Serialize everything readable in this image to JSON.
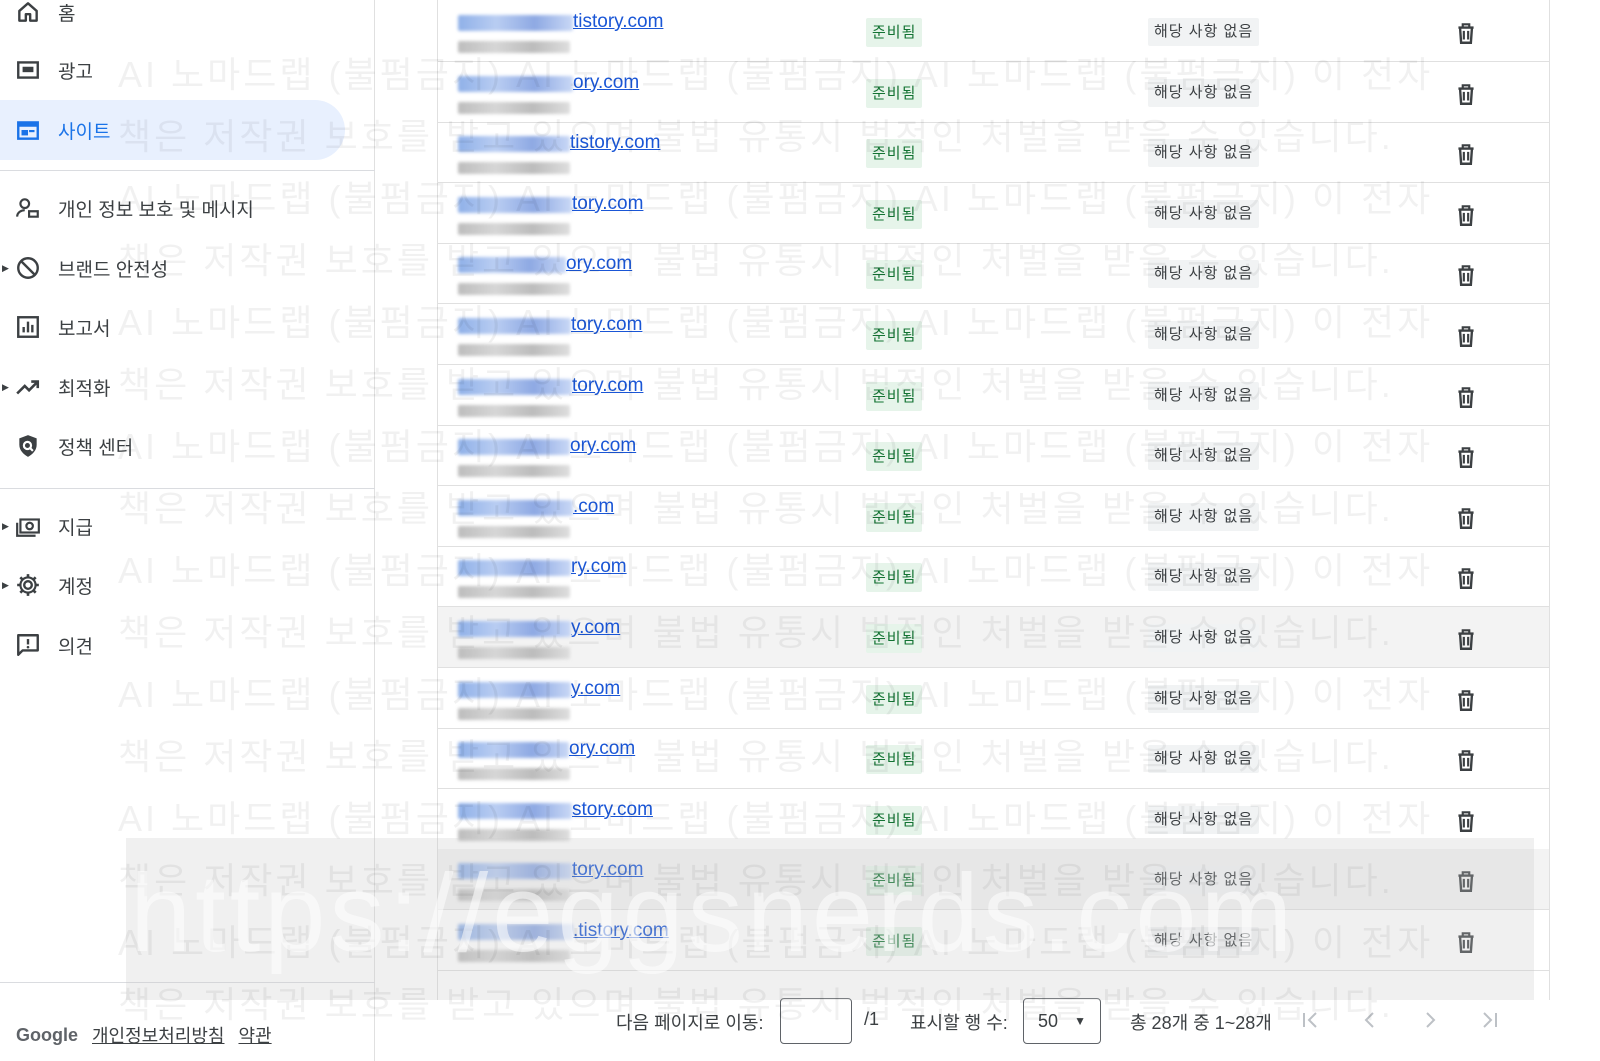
{
  "sidebar": {
    "items": [
      {
        "label": "홈",
        "icon": "home-icon"
      },
      {
        "label": "광고",
        "icon": "ads-icon"
      },
      {
        "label": "사이트",
        "icon": "sites-icon",
        "active": true
      },
      {
        "label": "개인 정보 보호 및 메시지",
        "icon": "privacy-messaging-icon"
      },
      {
        "label": "브랜드 안전성",
        "icon": "block-icon",
        "expandable": true
      },
      {
        "label": "보고서",
        "icon": "reports-icon"
      },
      {
        "label": "최적화",
        "icon": "trending-up-icon",
        "expandable": true
      },
      {
        "label": "정책 센터",
        "icon": "policy-shield-icon"
      },
      {
        "label": "지급",
        "icon": "payments-icon",
        "expandable": true
      },
      {
        "label": "계정",
        "icon": "gear-icon",
        "expandable": true
      },
      {
        "label": "의견",
        "icon": "feedback-icon"
      }
    ],
    "footer": {
      "brand": "Google",
      "privacy_link": "개인정보처리방침",
      "terms_link": "약관"
    }
  },
  "table": {
    "rows": [
      {
        "site": "tistory.com",
        "status": "준비됨",
        "issues": "해당 사항 없음"
      },
      {
        "site": "ory.com",
        "status": "준비됨",
        "issues": "해당 사항 없음"
      },
      {
        "site": "tistory.com",
        "status": "준비됨",
        "issues": "해당 사항 없음"
      },
      {
        "site": "tory.com",
        "status": "준비됨",
        "issues": "해당 사항 없음"
      },
      {
        "site": "ory.com",
        "status": "준비됨",
        "issues": "해당 사항 없음"
      },
      {
        "site": "tory.com",
        "status": "준비됨",
        "issues": "해당 사항 없음"
      },
      {
        "site": "tory.com",
        "status": "준비됨",
        "issues": "해당 사항 없음"
      },
      {
        "site": "ory.com",
        "status": "준비됨",
        "issues": "해당 사항 없음"
      },
      {
        "site": ".com",
        "status": "준비됨",
        "issues": "해당 사항 없음"
      },
      {
        "site": "ry.com",
        "status": "준비됨",
        "issues": "해당 사항 없음"
      },
      {
        "site": "y.com",
        "status": "준비됨",
        "issues": "해당 사항 없음"
      },
      {
        "site": "y.com",
        "status": "준비됨",
        "issues": "해당 사항 없음"
      },
      {
        "site": "ory.com",
        "status": "준비됨",
        "issues": "해당 사항 없음"
      },
      {
        "site": "story.com",
        "status": "준비됨",
        "issues": "해당 사항 없음"
      },
      {
        "site": "tory.com",
        "status": "준비됨",
        "issues": "해당 사항 없음"
      },
      {
        "site": ".tistory.com",
        "status": "준비됨",
        "issues": "해당 사항 없음"
      }
    ],
    "delete_icon": "trash-icon"
  },
  "pagination": {
    "goto_label": "다음 페이지로 이동:",
    "goto_value": "",
    "total_pages": "/1",
    "rows_label": "표시할 행 수:",
    "rows_value": "50",
    "range_text": "총 28개 중 1~28개"
  },
  "watermark": {
    "line_a": "AI 노마드랩 (불펌금지) AI 노마드랩 (불펌금지) AI 노마드랩 (불펌금지) 이 전자",
    "line_b": "책은 저작권 보호를 받고 있으며 불법 유통시 법적인 처벌을 받을 수 있습니다.",
    "url": "https://eggsnerds.com"
  },
  "colors": {
    "accent": "#1a73e8",
    "active_bg": "#e8f0fe",
    "link": "#1a56d6",
    "status_bg": "#e6f4ea",
    "status_text": "#137333"
  }
}
